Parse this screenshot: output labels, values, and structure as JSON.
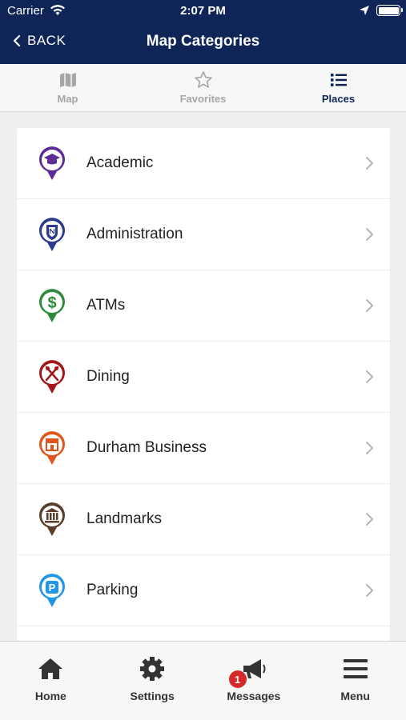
{
  "status_bar": {
    "carrier": "Carrier",
    "time": "2:07 PM"
  },
  "nav": {
    "back_label": "BACK",
    "title": "Map Categories"
  },
  "tabs": [
    {
      "label": "Map",
      "icon": "map-icon",
      "active": false
    },
    {
      "label": "Favorites",
      "icon": "star-icon",
      "active": false
    },
    {
      "label": "Places",
      "icon": "list-icon",
      "active": true
    }
  ],
  "categories": [
    {
      "label": "Academic",
      "icon": "graduation-cap-icon",
      "color": "#5b2b96"
    },
    {
      "label": "Administration",
      "icon": "shield-icon",
      "color": "#2c3a8e"
    },
    {
      "label": "ATMs",
      "icon": "dollar-icon",
      "color": "#2e8b3a"
    },
    {
      "label": "Dining",
      "icon": "utensils-icon",
      "color": "#a3161a"
    },
    {
      "label": "Durham Business",
      "icon": "storefront-icon",
      "color": "#e0551c"
    },
    {
      "label": "Landmarks",
      "icon": "landmark-icon",
      "color": "#5a3e2b"
    },
    {
      "label": "Parking",
      "icon": "parking-icon",
      "color": "#2196e8"
    }
  ],
  "bottom_bar": {
    "home_label": "Home",
    "settings_label": "Settings",
    "messages_label": "Messages",
    "messages_badge": "1",
    "menu_label": "Menu"
  },
  "colors": {
    "navy": "#0f2457",
    "inactive_tab": "#a6a6a6",
    "badge": "#d42a2a"
  }
}
